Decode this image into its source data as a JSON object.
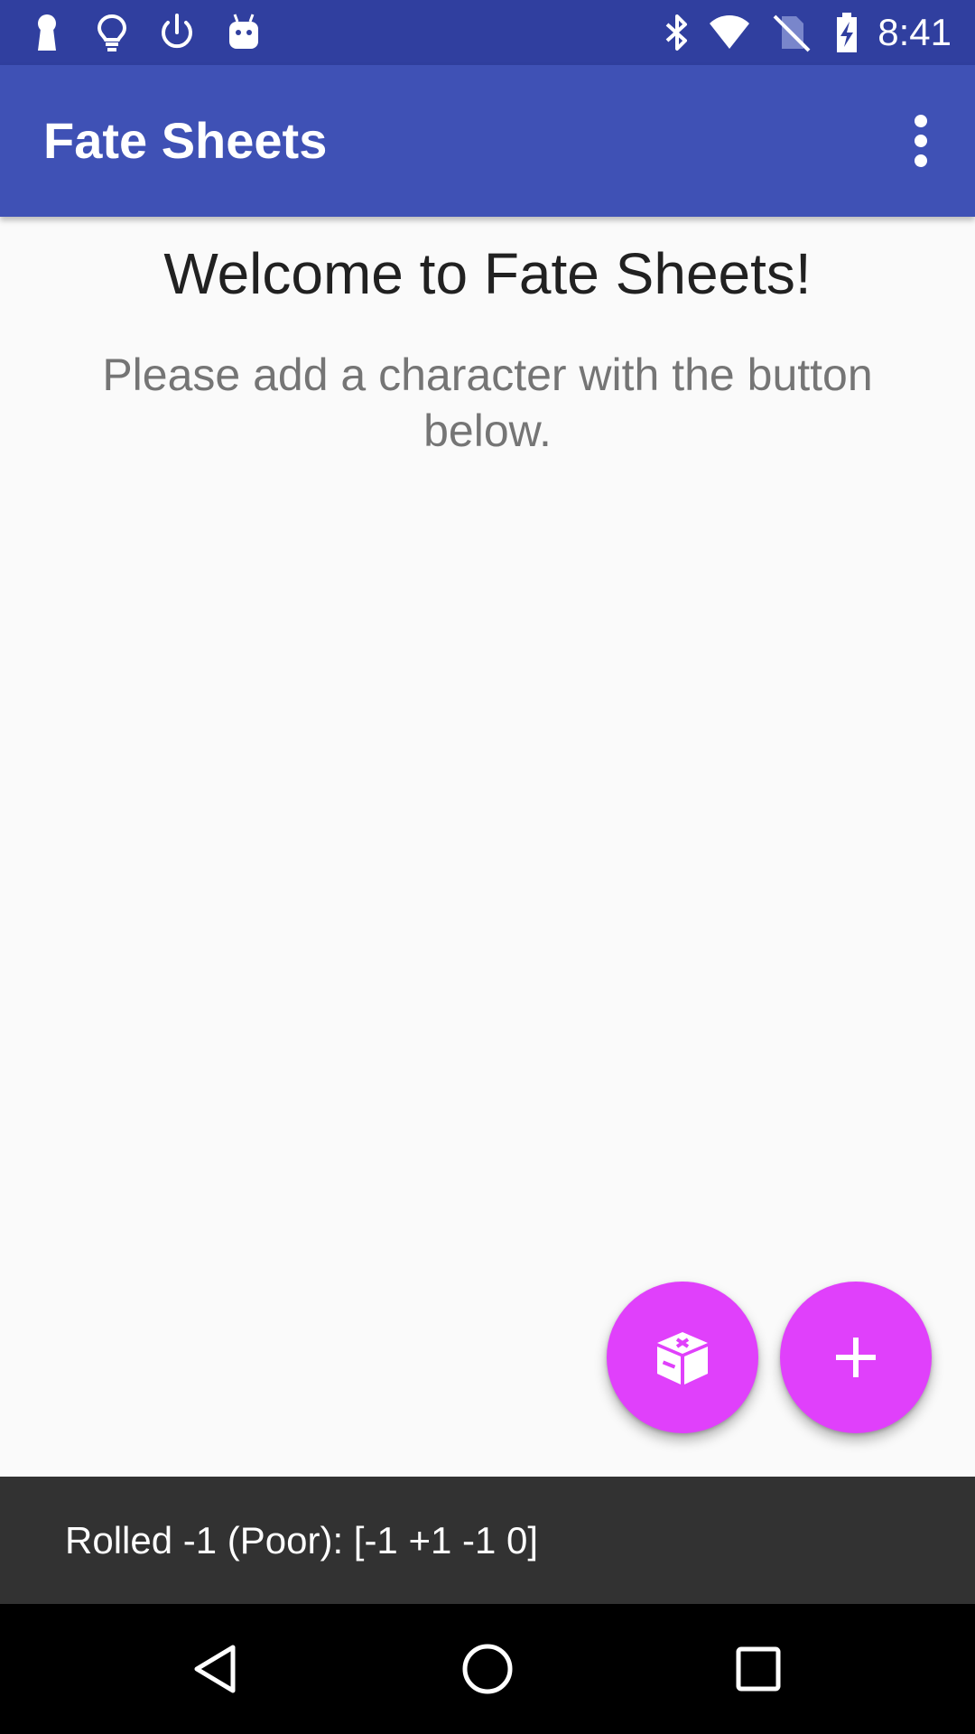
{
  "status_bar": {
    "time": "8:41",
    "left_icons": [
      "keyhole-icon",
      "lightbulb-icon",
      "power-icon",
      "android-icon"
    ],
    "right_icons": [
      "bluetooth-icon",
      "wifi-icon",
      "no-sim-icon",
      "battery-charging-icon"
    ]
  },
  "app_bar": {
    "title": "Fate Sheets",
    "overflow_icon": "more-vert-icon"
  },
  "content": {
    "welcome_title": "Welcome to Fate Sheets!",
    "welcome_body": "Please add a character with the button below."
  },
  "fabs": {
    "dice_icon": "dice-icon",
    "add_icon": "add-icon"
  },
  "snackbar": {
    "message": "Rolled -1 (Poor): [-1 +1 -1 0]"
  },
  "nav_bar": {
    "icons": [
      "back-icon",
      "home-icon",
      "recents-icon"
    ]
  },
  "colors": {
    "status_bar": "#303f9f",
    "app_bar": "#3f51b5",
    "fab_accent": "#e040fb",
    "snackbar": "#323232",
    "background": "#fafafa"
  }
}
